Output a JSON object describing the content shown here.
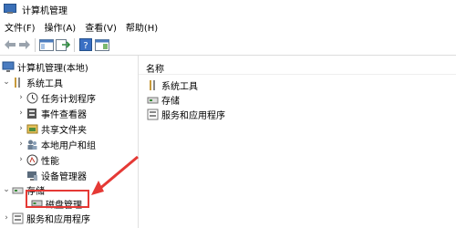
{
  "window": {
    "title": "计算机管理",
    "icon": "computer-management-icon"
  },
  "menubar": {
    "items": [
      {
        "label": "文件(F)"
      },
      {
        "label": "操作(A)"
      },
      {
        "label": "查看(V)"
      },
      {
        "label": "帮助(H)"
      }
    ]
  },
  "toolbar": {
    "buttons": [
      {
        "icon": "back-arrow-icon"
      },
      {
        "icon": "forward-arrow-icon"
      },
      {
        "icon": "show-hide-console-tree-icon"
      },
      {
        "icon": "export-list-icon"
      },
      {
        "icon": "help-icon"
      },
      {
        "icon": "properties-icon"
      }
    ]
  },
  "tree": {
    "root": {
      "label": "计算机管理(本地)",
      "icon": "computer-icon"
    },
    "system_tools": {
      "label": "系统工具",
      "icon": "tools-icon",
      "expanded": true,
      "children": [
        {
          "label": "任务计划程序",
          "icon": "clock-icon"
        },
        {
          "label": "事件查看器",
          "icon": "event-viewer-icon"
        },
        {
          "label": "共享文件夹",
          "icon": "shared-folder-icon"
        },
        {
          "label": "本地用户和组",
          "icon": "users-icon"
        },
        {
          "label": "性能",
          "icon": "performance-icon"
        },
        {
          "label": "设备管理器",
          "icon": "device-manager-icon"
        }
      ]
    },
    "storage": {
      "label": "存储",
      "icon": "storage-icon",
      "expanded": true,
      "children": [
        {
          "label": "磁盘管理",
          "icon": "disk-icon",
          "highlighted": true
        }
      ]
    },
    "services": {
      "label": "服务和应用程序",
      "icon": "services-icon"
    }
  },
  "list": {
    "column_header": "名称",
    "items": [
      {
        "label": "系统工具",
        "icon": "tools-icon"
      },
      {
        "label": "存储",
        "icon": "storage-icon"
      },
      {
        "label": "服务和应用程序",
        "icon": "services-icon"
      }
    ]
  },
  "annotation": {
    "color": "#e53935"
  }
}
